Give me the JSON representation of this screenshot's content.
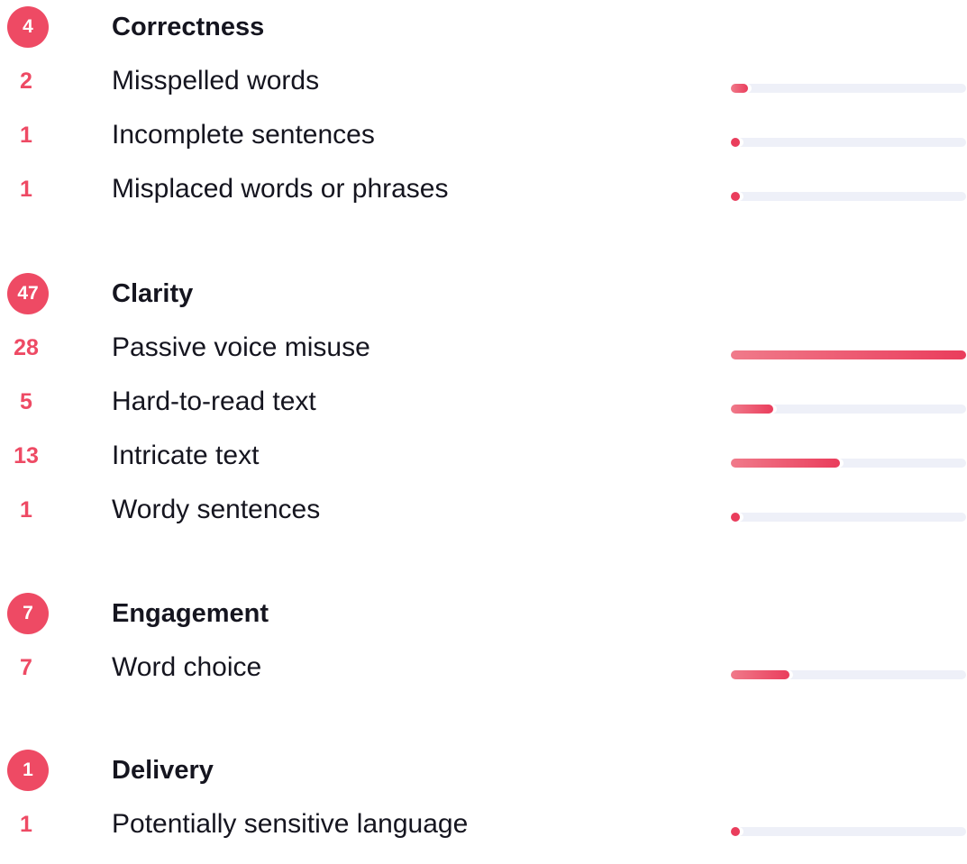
{
  "max_count": 28,
  "colors": {
    "accent": "#ee4a64",
    "track": "#eef0f8",
    "text": "#15151f"
  },
  "categories": [
    {
      "name": "Correctness",
      "count": "4",
      "issues": [
        {
          "label": "Misspelled words",
          "count": "2",
          "value": 2
        },
        {
          "label": "Incomplete sentences",
          "count": "1",
          "value": 1
        },
        {
          "label": "Misplaced words or phrases",
          "count": "1",
          "value": 1
        }
      ]
    },
    {
      "name": "Clarity",
      "count": "47",
      "issues": [
        {
          "label": "Passive voice misuse",
          "count": "28",
          "value": 28
        },
        {
          "label": "Hard-to-read text",
          "count": "5",
          "value": 5
        },
        {
          "label": "Intricate text",
          "count": "13",
          "value": 13
        },
        {
          "label": "Wordy sentences",
          "count": "1",
          "value": 1
        }
      ]
    },
    {
      "name": "Engagement",
      "count": "7",
      "issues": [
        {
          "label": "Word choice",
          "count": "7",
          "value": 7
        }
      ]
    },
    {
      "name": "Delivery",
      "count": "1",
      "issues": [
        {
          "label": "Potentially sensitive language",
          "count": "1",
          "value": 1
        }
      ]
    }
  ]
}
